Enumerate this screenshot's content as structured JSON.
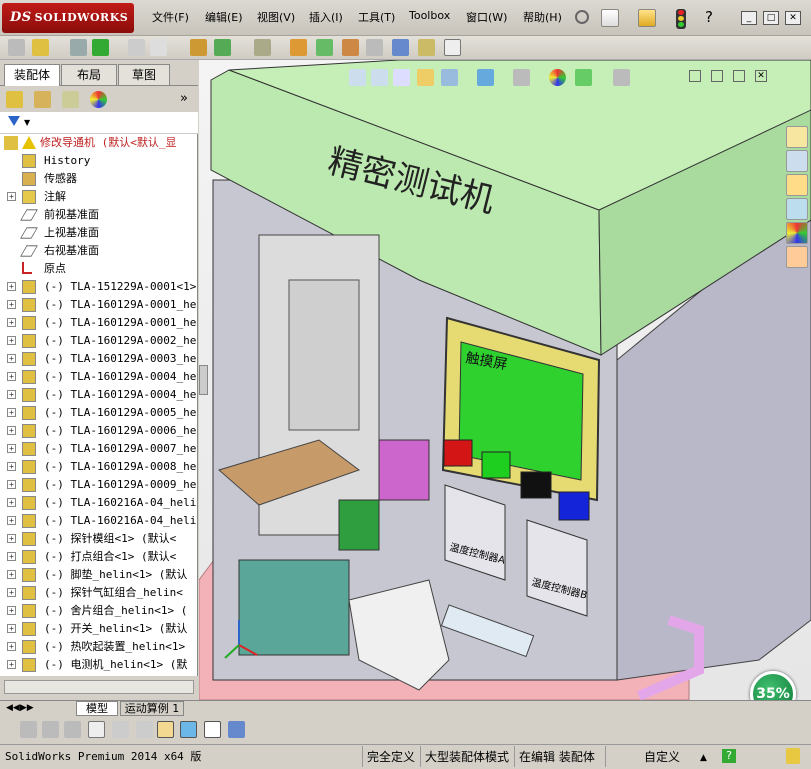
{
  "app": {
    "brand": "SOLIDWORKS",
    "brand_prefix": "DS"
  },
  "menu": [
    "文件(F)",
    "编辑(E)",
    "视图(V)",
    "插入(I)",
    "工具(T)",
    "Toolbox",
    "窗口(W)",
    "帮助(H)"
  ],
  "panel_tabs": [
    "装配体",
    "布局",
    "草图"
  ],
  "tree": {
    "root": "修改导通机  (默认<默认_显",
    "items": [
      {
        "label": "History",
        "icon": "history-icon",
        "expand": false
      },
      {
        "label": "传感器",
        "icon": "sensor-icon",
        "expand": false
      },
      {
        "label": "注解",
        "icon": "annotation-icon",
        "expand": true
      },
      {
        "label": "前视基准面",
        "icon": "plane-icon",
        "expand": false
      },
      {
        "label": "上视基准面",
        "icon": "plane-icon",
        "expand": false
      },
      {
        "label": "右视基准面",
        "icon": "plane-icon",
        "expand": false
      },
      {
        "label": "原点",
        "icon": "origin-icon",
        "expand": false
      },
      {
        "label": "(-) TLA-151229A-0001<1>",
        "icon": "component-icon",
        "expand": true
      },
      {
        "label": "(-) TLA-160129A-0001_he",
        "icon": "component-icon",
        "expand": true
      },
      {
        "label": "(-) TLA-160129A-0001_he",
        "icon": "component-icon",
        "expand": true
      },
      {
        "label": "(-) TLA-160129A-0002_he",
        "icon": "component-icon",
        "expand": true
      },
      {
        "label": "(-) TLA-160129A-0003_he",
        "icon": "component-icon",
        "expand": true
      },
      {
        "label": "(-) TLA-160129A-0004_he",
        "icon": "component-icon",
        "expand": true
      },
      {
        "label": "(-) TLA-160129A-0004_he",
        "icon": "component-icon",
        "expand": true
      },
      {
        "label": "(-) TLA-160129A-0005_he",
        "icon": "component-icon",
        "expand": true
      },
      {
        "label": "(-) TLA-160129A-0006_he",
        "icon": "component-icon",
        "expand": true
      },
      {
        "label": "(-) TLA-160129A-0007_he",
        "icon": "component-icon",
        "expand": true
      },
      {
        "label": "(-) TLA-160129A-0008_he",
        "icon": "component-icon",
        "expand": true
      },
      {
        "label": "(-) TLA-160129A-0009_he",
        "icon": "component-icon",
        "expand": true
      },
      {
        "label": "(-) TLA-160216A-04_heli",
        "icon": "component-icon",
        "expand": true
      },
      {
        "label": "(-) TLA-160216A-04_heli",
        "icon": "component-icon",
        "expand": true
      },
      {
        "label": "(-) 探针模组<1> (默认<",
        "icon": "component-icon",
        "expand": true
      },
      {
        "label": "(-) 打点组合<1> (默认<",
        "icon": "component-icon",
        "expand": true
      },
      {
        "label": "(-) 脚垫_helin<1> (默认",
        "icon": "component-icon",
        "expand": true
      },
      {
        "label": "(-) 探针气缸组合_helin<",
        "icon": "component-icon",
        "expand": true
      },
      {
        "label": "(-) 舍片组合_helin<1> (",
        "icon": "component-icon",
        "expand": true
      },
      {
        "label": "(-) 开关_helin<1> (默认",
        "icon": "component-icon",
        "expand": true
      },
      {
        "label": "(-) 热吹起装置_helin<1>",
        "icon": "component-icon",
        "expand": true
      },
      {
        "label": "(-) 电测机_helin<1> (默",
        "icon": "component-icon",
        "expand": true
      }
    ]
  },
  "model": {
    "title_text": "精密测试机",
    "screen_label": "触摸屏",
    "meter_a": "温度控制器A",
    "meter_b": "温度控制器B",
    "colors": {
      "lid": "#b8e6ae",
      "panel": "#c7c7d2",
      "screen_frame": "#e6da73",
      "screen": "#2fd12f",
      "base": "#f2b2b8"
    }
  },
  "bottom_tabs": [
    "模型",
    "运动算例 1"
  ],
  "status": {
    "product": "SolidWorks Premium 2014 x64 版",
    "fully_defined": "完全定义",
    "large_mode": "大型装配体模式",
    "editing": "在编辑 装配体",
    "custom": "自定义",
    "help": "?"
  },
  "progress_badge": "35%"
}
